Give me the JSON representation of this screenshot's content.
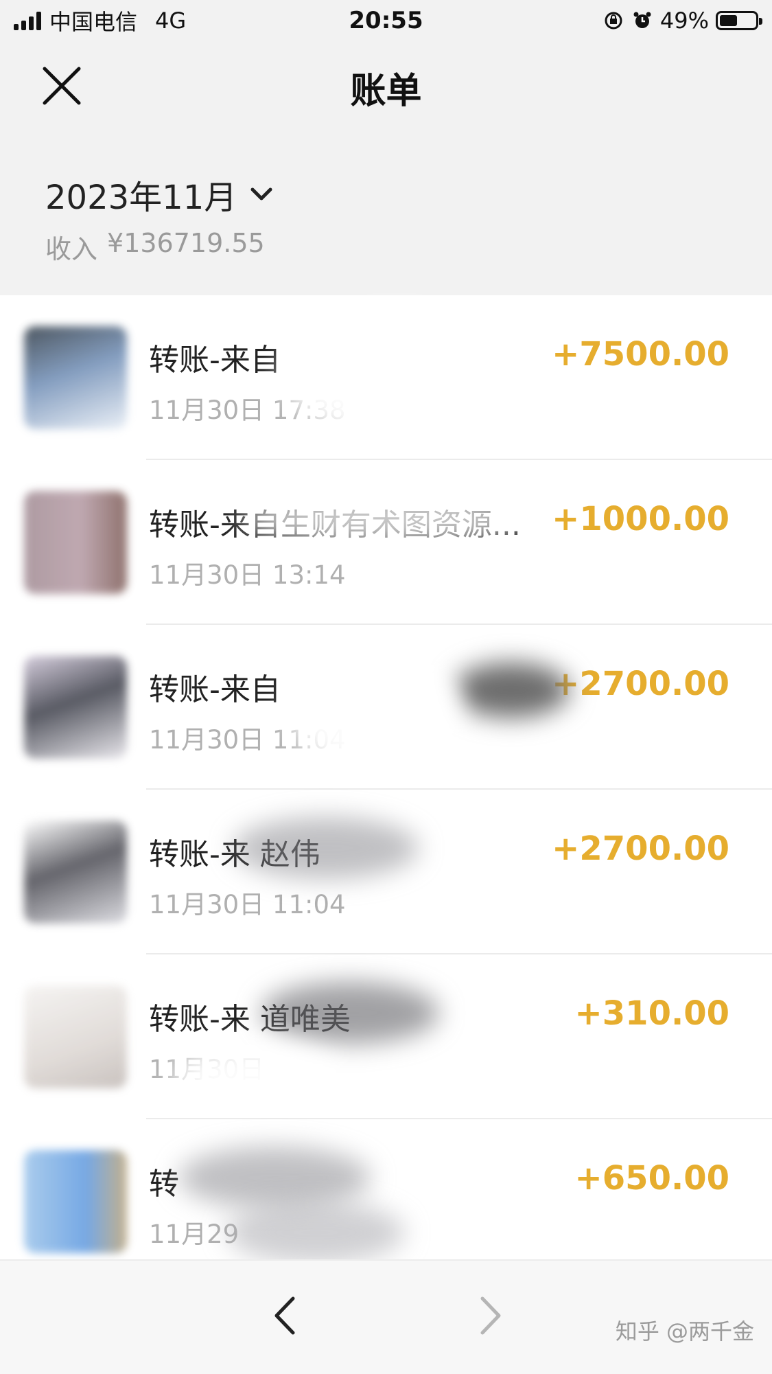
{
  "status_bar": {
    "carrier": "中国电信",
    "network": "4G",
    "time": "20:55",
    "battery": "49%",
    "battery_level": 0.49
  },
  "nav": {
    "title": "账单",
    "close_icon": "close-icon"
  },
  "summary": {
    "month": "2023年11月",
    "income_label": "收入",
    "income_value": "¥136719.55"
  },
  "transactions": [
    {
      "title": "转账-来自",
      "time": "11月30日 17:38",
      "amount": "+7500.00"
    },
    {
      "title": "转账-来自生财有术图资源...",
      "time": "11月30日 13:14",
      "amount": "+1000.00"
    },
    {
      "title": "转账-来自",
      "time": "11月30日 11:04",
      "amount": "+2700.00"
    },
    {
      "title": "转账-来                    赵伟",
      "time": "11月30日 11:04",
      "amount": "+2700.00"
    },
    {
      "title": "转账-来                 道唯美",
      "time": "11月30日",
      "amount": "+310.00"
    },
    {
      "title": "转",
      "time": "11月29",
      "amount": "+650.00"
    }
  ],
  "bottom": {
    "prev_icon": "chevron-left-icon",
    "next_icon": "chevron-right-icon",
    "watermark": "知乎 @两千金"
  },
  "colors": {
    "amount": "#e6ad2e",
    "header_bg": "#f2f2f2"
  }
}
